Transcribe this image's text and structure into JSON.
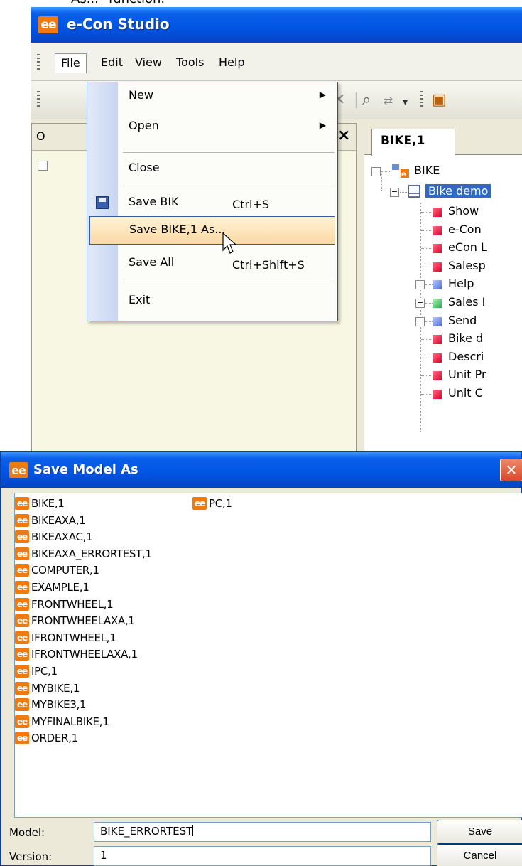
{
  "caption": "As...\" function.",
  "app": {
    "title": "e-Con Studio",
    "logo": "ee-logo",
    "menu": [
      "File",
      "Edit",
      "View",
      "Tools",
      "Help"
    ],
    "left_pane_header": "O",
    "right_tab": "BIKE,1",
    "tree": {
      "root": "BIKE",
      "selected": "Bike demo",
      "children": [
        {
          "label": "Show",
          "color": "red"
        },
        {
          "label": "e-Con",
          "color": "red"
        },
        {
          "label": "eCon L",
          "color": "red"
        },
        {
          "label": "Salesp",
          "color": "red"
        },
        {
          "label": "Help",
          "color": "blue",
          "expandable": true
        },
        {
          "label": "Sales I",
          "color": "green",
          "expandable": true
        },
        {
          "label": "Send",
          "color": "blue",
          "expandable": true
        },
        {
          "label": "Bike d",
          "color": "red"
        },
        {
          "label": "Descri",
          "color": "red"
        },
        {
          "label": "Unit Pr",
          "color": "red"
        },
        {
          "label": "Unit C",
          "color": "red"
        }
      ]
    }
  },
  "file_menu": {
    "new": "New",
    "open": "Open",
    "close": "Close",
    "save": {
      "label": "Save BIK",
      "shortcut": "Ctrl+S"
    },
    "save_as": "Save BIKE,1 As...",
    "save_all": {
      "label": "Save All",
      "shortcut": "Ctrl+Shift+S"
    },
    "exit": "Exit"
  },
  "dialog": {
    "title": "Save Model As",
    "close_glyph": "✕",
    "models": [
      "BIKE,1",
      "BIKEAXA,1",
      "BIKEAXAC,1",
      "BIKEAXA_ERRORTEST,1",
      "COMPUTER,1",
      "EXAMPLE,1",
      "FRONTWHEEL,1",
      "FRONTWHEELAXA,1",
      "IFRONTWHEEL,1",
      "IFRONTWHEELAXA,1",
      "IPC,1",
      "MYBIKE,1",
      "MYBIKE3,1",
      "MYFINALBIKE,1",
      "ORDER,1"
    ],
    "models_col2": [
      "PC,1"
    ],
    "model_label": "Model:",
    "model_value": "BIKE_ERRORTEST",
    "version_label": "Version:",
    "version_value": "1",
    "save_button": "Save",
    "cancel_button": "Cancel"
  },
  "colors": {
    "titlebar": "#0054e3",
    "logo_orange": "#f07a10",
    "menu_highlight": "#fbd9a4",
    "selection": "#316ac5"
  }
}
